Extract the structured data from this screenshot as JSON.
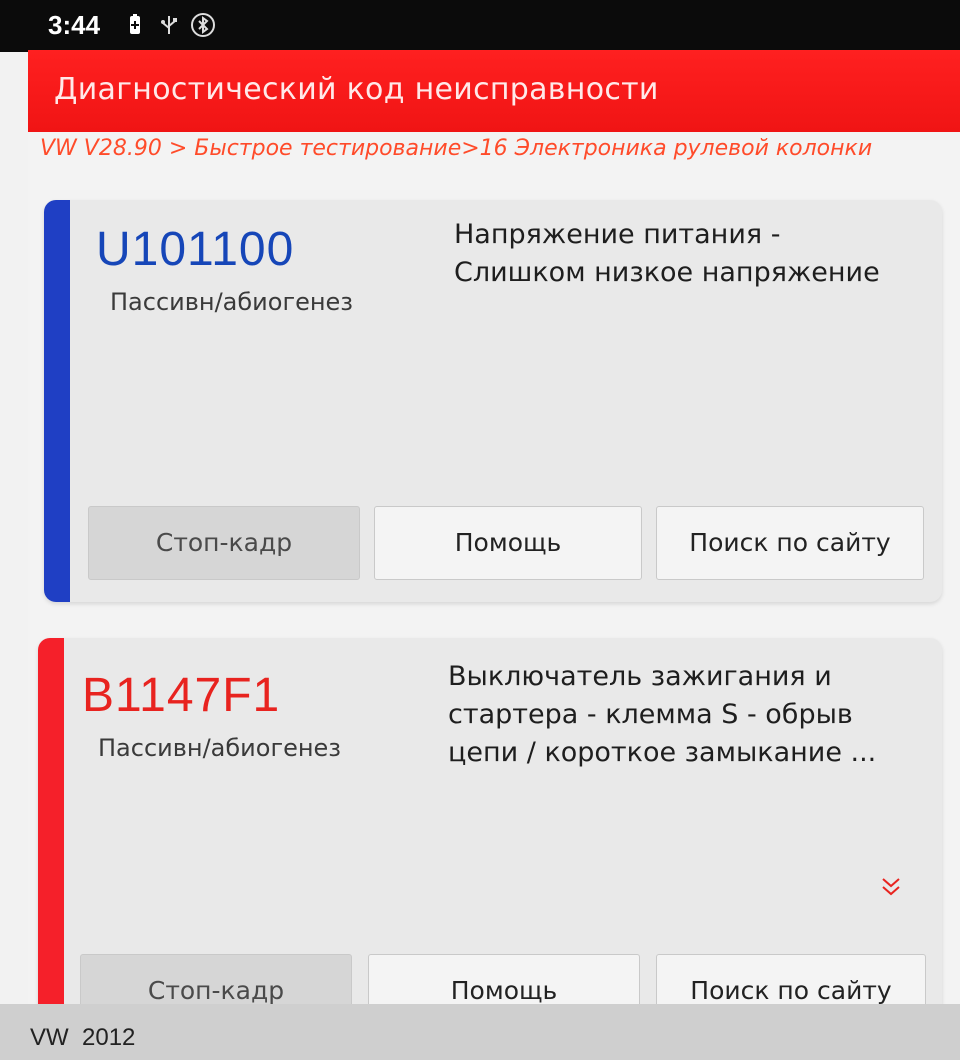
{
  "status_bar": {
    "time": "3:44",
    "icons": [
      "battery-saver-icon",
      "usb-icon",
      "bluetooth-icon"
    ]
  },
  "header": {
    "title": "Диагностический код неисправности",
    "color": "#f01414"
  },
  "breadcrumb": "VW V28.90 > Быстрое тестирование>16 Электроника рулевой колонки",
  "dtc_list": [
    {
      "code": "U101100",
      "code_color": "#1646b8",
      "bar_color": "#1f3fc4",
      "status": "Пассивн/абиогенез",
      "description_lines": [
        "Напряжение питания -",
        "Слишком низкое напряжение"
      ],
      "buttons": {
        "freeze_frame": "Стоп-кадр",
        "help": "Помощь",
        "web_search": "Поиск по сайту"
      }
    },
    {
      "code": "B1147F1",
      "code_color": "#e8231f",
      "bar_color": "#f5202a",
      "status": "Пассивн/абиогенез",
      "description_lines": [
        "Выключатель зажигания и",
        "стартера - клемма S - обрыв",
        "цепи / короткое замыкание ..."
      ],
      "expand_icon": "chevron-double-down-icon",
      "buttons": {
        "freeze_frame": "Стоп-кадр",
        "help": "Помощь",
        "web_search": "Поиск по сайту"
      }
    }
  ],
  "footer": {
    "vehicle": "VW  2012"
  }
}
